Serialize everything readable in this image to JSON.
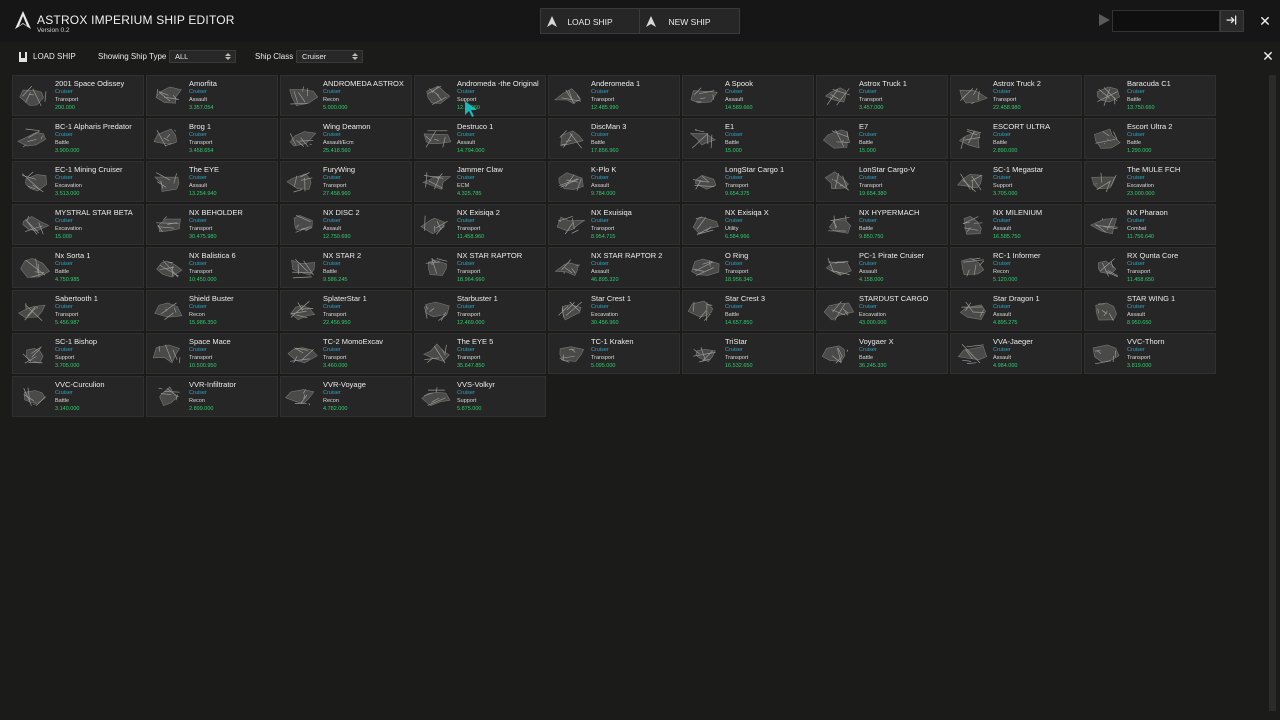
{
  "app": {
    "title": "ASTROX IMPERIUM SHIP EDITOR",
    "version": "Version 0.2"
  },
  "header": {
    "load_ship": "LOAD SHIP",
    "new_ship": "NEW SHIP",
    "input_value": "",
    "icons": {
      "logo": "astrox-logo",
      "play": "play-icon",
      "login": "login-arrow-icon",
      "close": "close-icon"
    }
  },
  "filters": {
    "load_ship": "LOAD SHIP",
    "type_label": "Showing Ship Type",
    "type_value": "ALL",
    "class_label": "Ship Class",
    "class_value": "Cruiser"
  },
  "colors": {
    "class_text": "#2ba7c9",
    "price_text": "#2fce6e",
    "background": "#1b1b1a",
    "card": "#262626"
  },
  "ships": [
    {
      "name": "2001 Space Odissey",
      "cls": "Cruiser",
      "role": "Transport",
      "price": "200.000"
    },
    {
      "name": "Amorfita",
      "cls": "Cruiser",
      "role": "Assault",
      "price": "3.357.054"
    },
    {
      "name": "ANDROMEDA ASTROX",
      "cls": "Cruiser",
      "role": "Recon",
      "price": "5.000.000"
    },
    {
      "name": "Andromeda -the Original",
      "cls": "Cruiser",
      "role": "Support",
      "price": "12.... 960"
    },
    {
      "name": "Anderomeda 1",
      "cls": "Cruiser",
      "role": "Transport",
      "price": "12.485.990"
    },
    {
      "name": "A Spook",
      "cls": "Cruiser",
      "role": "Assault",
      "price": "14.589.660"
    },
    {
      "name": "Astrox Truck 1",
      "cls": "Cruiser",
      "role": "Transport",
      "price": "3.457.000"
    },
    {
      "name": "Astrox Truck 2",
      "cls": "Cruiser",
      "role": "Transport",
      "price": "22.458.980"
    },
    {
      "name": "Baracuda C1",
      "cls": "Cruiser",
      "role": "Battle",
      "price": "13.750.660"
    },
    {
      "name": "BC-1 Alpharis Predator",
      "cls": "Cruiser",
      "role": "Battle",
      "price": "3.900.000"
    },
    {
      "name": "Brog 1",
      "cls": "Cruiser",
      "role": "Transport",
      "price": "3.458.654"
    },
    {
      "name": "Wing Deamon",
      "cls": "Cruiser",
      "role": "Assault/Ecm",
      "price": "25.418.560"
    },
    {
      "name": "Destruco 1",
      "cls": "Cruiser",
      "role": "Assault",
      "price": "14.794.000"
    },
    {
      "name": "DiscMan 3",
      "cls": "Cruiser",
      "role": "Battle",
      "price": "17.856.960"
    },
    {
      "name": "E1",
      "cls": "Cruiser",
      "role": "Battle",
      "price": "15.000"
    },
    {
      "name": "E7",
      "cls": "Cruiser",
      "role": "Battle",
      "price": "15.000"
    },
    {
      "name": "ESCORT ULTRA",
      "cls": "Cruiser",
      "role": "Battle",
      "price": "2.890.000"
    },
    {
      "name": "Escort Ultra 2",
      "cls": "Cruiser",
      "role": "Battle",
      "price": "1.290.000"
    },
    {
      "name": "EC-1 Mining Cruiser",
      "cls": "Cruiser",
      "role": "Excavation",
      "price": "3.513.000"
    },
    {
      "name": "The EYE",
      "cls": "Cruiser",
      "role": "Assault",
      "price": "13.254.940"
    },
    {
      "name": "FuryWing",
      "cls": "Cruiser",
      "role": "Transport",
      "price": "27.458.960"
    },
    {
      "name": "Jammer Claw",
      "cls": "Cruiser",
      "role": "ECM",
      "price": "4.325.785"
    },
    {
      "name": "K-Plo K",
      "cls": "Cruiser",
      "role": "Assault",
      "price": "9.784.000"
    },
    {
      "name": "LongStar Cargo 1",
      "cls": "Cruiser",
      "role": "Transport",
      "price": "9.654.375"
    },
    {
      "name": "LonStar Cargo-V",
      "cls": "Cruiser",
      "role": "Transport",
      "price": "19.654.380"
    },
    {
      "name": "SC-1 Megastar",
      "cls": "Cruiser",
      "role": "Support",
      "price": "3.705.000"
    },
    {
      "name": "The MULE FCH",
      "cls": "Cruiser",
      "role": "Excavation",
      "price": "23.000.000"
    },
    {
      "name": "MYSTRAL STAR BETA",
      "cls": "Cruiser",
      "role": "Excavation",
      "price": "15.000"
    },
    {
      "name": "NX BEHOLDER",
      "cls": "Cruiser",
      "role": "Transport",
      "price": "30.475.980"
    },
    {
      "name": "NX DISC 2",
      "cls": "Cruiser",
      "role": "Assault",
      "price": "12.750.690"
    },
    {
      "name": "NX Exisiqa 2",
      "cls": "Cruiser",
      "role": "Transport",
      "price": "11.458.960"
    },
    {
      "name": "NX Exuisiqa",
      "cls": "Cruiser",
      "role": "Transport",
      "price": "8.954.715"
    },
    {
      "name": "NX Exisiqa X",
      "cls": "Cruiser",
      "role": "Utility",
      "price": "6.584.966"
    },
    {
      "name": "NX HYPERMACH",
      "cls": "Cruiser",
      "role": "Battle",
      "price": "9.850.750"
    },
    {
      "name": "NX MILENIUM",
      "cls": "Cruiser",
      "role": "Assault",
      "price": "16.585.750"
    },
    {
      "name": "NX Pharaon",
      "cls": "Cruiser",
      "role": "Combat",
      "price": "11.756.640"
    },
    {
      "name": "Nx Sorta 1",
      "cls": "Cruiser",
      "role": "Battle",
      "price": "4.750.985"
    },
    {
      "name": "NX Balistica 6",
      "cls": "Cruiser",
      "role": "Transport",
      "price": "10.450.000"
    },
    {
      "name": "NX STAR 2",
      "cls": "Cruiser",
      "role": "Battle",
      "price": "9.586.245"
    },
    {
      "name": "NX STAR RAPTOR",
      "cls": "Cruiser",
      "role": "Transport",
      "price": "18.964.660"
    },
    {
      "name": "NX STAR RAPTOR 2",
      "cls": "Cruiser",
      "role": "Assault",
      "price": "46.895.320"
    },
    {
      "name": "O Ring",
      "cls": "Cruiser",
      "role": "Transport",
      "price": "18.956.340"
    },
    {
      "name": "PC-1 Pirate Cruiser",
      "cls": "Cruiser",
      "role": "Assault",
      "price": "4.158.000"
    },
    {
      "name": "RC-1 Informer",
      "cls": "Cruiser",
      "role": "Recon",
      "price": "5.120.000"
    },
    {
      "name": "RX Qunta Core",
      "cls": "Cruiser",
      "role": "Transport",
      "price": "11.458.650"
    },
    {
      "name": "Sabertooth 1",
      "cls": "Cruiser",
      "role": "Transport",
      "price": "5.456.987"
    },
    {
      "name": "Shield Buster",
      "cls": "Cruiser",
      "role": "Recon",
      "price": "15.986.350"
    },
    {
      "name": "SplaterStar 1",
      "cls": "Cruiser",
      "role": "Transport",
      "price": "22.456.950"
    },
    {
      "name": "Starbuster 1",
      "cls": "Cruiser",
      "role": "Transport",
      "price": "12.469.000"
    },
    {
      "name": "Star Crest 1",
      "cls": "Cruiser",
      "role": "Excavation",
      "price": "30.456.960"
    },
    {
      "name": "Star Crest 3",
      "cls": "Cruiser",
      "role": "Battle",
      "price": "14.657.850"
    },
    {
      "name": "STARDUST CARGO",
      "cls": "Cruiser",
      "role": "Excavation",
      "price": "43.000.000"
    },
    {
      "name": "Star Dragon 1",
      "cls": "Cruiser",
      "role": "Assault",
      "price": "4.895.275"
    },
    {
      "name": "STAR WING 1",
      "cls": "Cruiser",
      "role": "Assault",
      "price": "8.950.650"
    },
    {
      "name": "SC-1 Bishop",
      "cls": "Cruiser",
      "role": "Support",
      "price": "3.705.000"
    },
    {
      "name": "Space Mace",
      "cls": "Cruiser",
      "role": "Transport",
      "price": "10.500.950"
    },
    {
      "name": "TC-2 MomoExcav",
      "cls": "Cruiser",
      "role": "Transport",
      "price": "3.460.000"
    },
    {
      "name": "The EYE 5",
      "cls": "Cruiser",
      "role": "Transport",
      "price": "35.647.850"
    },
    {
      "name": "TC-1 Kraken",
      "cls": "Cruiser",
      "role": "Transport",
      "price": "5.095.000"
    },
    {
      "name": "TriStar",
      "cls": "Cruiser",
      "role": "Transport",
      "price": "16.532.650"
    },
    {
      "name": "Voygaer X",
      "cls": "Cruiser",
      "role": "Battle",
      "price": "36.245.330"
    },
    {
      "name": "VVA-Jaeger",
      "cls": "Cruiser",
      "role": "Assault",
      "price": "4.984.000"
    },
    {
      "name": "VVC-Thorn",
      "cls": "Cruiser",
      "role": "Transport",
      "price": "3.819.000"
    },
    {
      "name": "VVC-Curculion",
      "cls": "Cruiser",
      "role": "Battle",
      "price": "3.140.000"
    },
    {
      "name": "VVR-Infiltrator",
      "cls": "Cruiser",
      "role": "Recon",
      "price": "2.899.000"
    },
    {
      "name": "VVR-Voyage",
      "cls": "Cruiser",
      "role": "Recon",
      "price": "4.782.000"
    },
    {
      "name": "VVS-Volkyr",
      "cls": "Cruiser",
      "role": "Support",
      "price": "5.875.000"
    }
  ]
}
